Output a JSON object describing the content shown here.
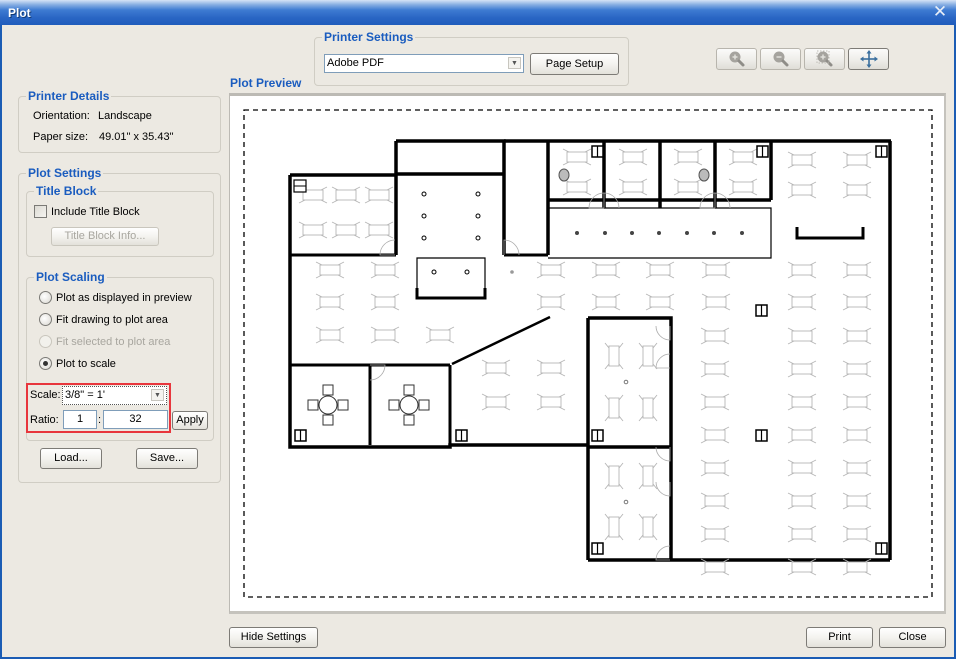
{
  "window": {
    "title": "Plot",
    "close_label": "✕"
  },
  "printer_settings": {
    "legend": "Printer Settings",
    "printer": "Adobe PDF",
    "page_setup_label": "Page Setup"
  },
  "zoom_toolbar": {
    "buttons": [
      {
        "name": "zoom-in",
        "enabled": false
      },
      {
        "name": "zoom-out",
        "enabled": false
      },
      {
        "name": "zoom-extents",
        "enabled": false
      },
      {
        "name": "pan",
        "enabled": true
      }
    ]
  },
  "printer_details": {
    "legend": "Printer Details",
    "orientation_label": "Orientation:",
    "orientation_value": "Landscape",
    "paper_size_label": "Paper size:",
    "paper_size_value": "49.01\" x 35.43\""
  },
  "plot_settings": {
    "legend": "Plot Settings",
    "title_block": {
      "legend": "Title Block",
      "include_label": "Include Title Block",
      "include_checked": false,
      "info_button_label": "Title Block Info..."
    },
    "plot_scaling": {
      "legend": "Plot Scaling",
      "options": [
        {
          "label": "Plot as displayed in preview",
          "selected": false,
          "enabled": true
        },
        {
          "label": "Fit drawing to plot area",
          "selected": false,
          "enabled": true
        },
        {
          "label": "Fit selected to plot area",
          "selected": false,
          "enabled": false
        },
        {
          "label": "Plot to scale",
          "selected": true,
          "enabled": true
        }
      ],
      "scale_label": "Scale:",
      "scale_value": "3/8\" = 1'",
      "ratio_label": "Ratio:",
      "ratio_left": "1",
      "ratio_separator": ":",
      "ratio_right": "32",
      "apply_label": "Apply"
    },
    "load_label": "Load...",
    "save_label": "Save..."
  },
  "preview": {
    "title": "Plot Preview"
  },
  "footer": {
    "hide_settings_label": "Hide Settings",
    "print_label": "Print",
    "close_label": "Close"
  },
  "colors": {
    "accent": "#1a5cbf",
    "highlight": "#e8363d",
    "titlebar": "#2a66c4"
  }
}
